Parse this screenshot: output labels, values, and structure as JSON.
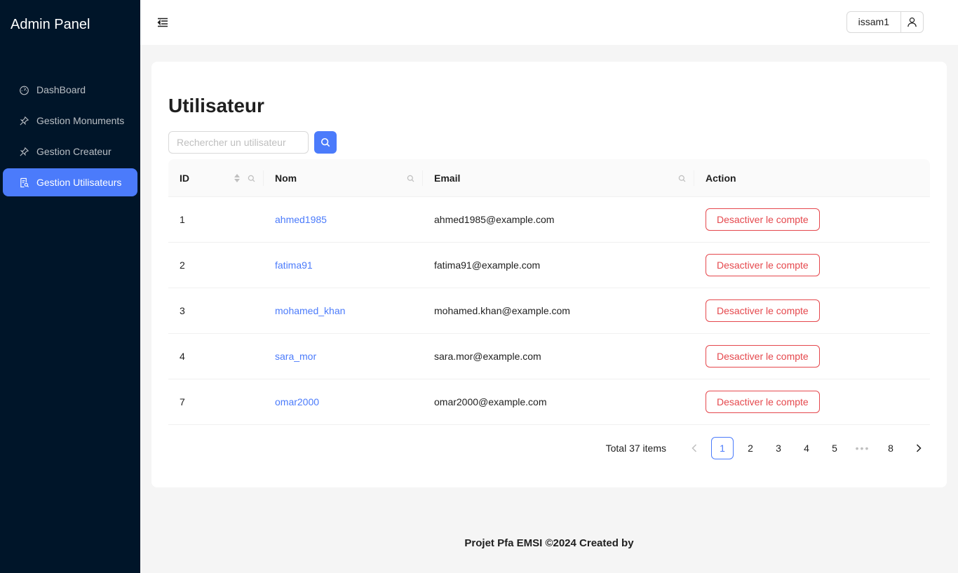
{
  "sidebar": {
    "brand": "Admin Panel",
    "items": [
      {
        "label": "DashBoard",
        "icon": "dashboard-icon",
        "active": false
      },
      {
        "label": "Gestion Monuments",
        "icon": "pushpin-icon",
        "active": false
      },
      {
        "label": "Gestion Createur",
        "icon": "pushpin-icon",
        "active": false
      },
      {
        "label": "Gestion Utilisateurs",
        "icon": "file-search-icon",
        "active": true
      }
    ]
  },
  "header": {
    "menu_icon": "menu-fold-icon",
    "username": "issam1",
    "user_icon": "user-icon"
  },
  "main": {
    "title": "Utilisateur",
    "search": {
      "placeholder": "Rechercher un utilisateur",
      "value": "",
      "button_icon": "search-icon"
    },
    "table": {
      "columns": [
        "ID",
        "Nom",
        "Email",
        "Action"
      ],
      "rows": [
        {
          "id": "1",
          "nom": "ahmed1985",
          "email": "ahmed1985@example.com",
          "action": "Desactiver le compte"
        },
        {
          "id": "2",
          "nom": "fatima91",
          "email": "fatima91@example.com",
          "action": "Desactiver le compte"
        },
        {
          "id": "3",
          "nom": "mohamed_khan",
          "email": "mohamed.khan@example.com",
          "action": "Desactiver le compte"
        },
        {
          "id": "4",
          "nom": "sara_mor",
          "email": "sara.mor@example.com",
          "action": "Desactiver le compte"
        },
        {
          "id": "7",
          "nom": "omar2000",
          "email": "omar2000@example.com",
          "action": "Desactiver le compte"
        }
      ]
    },
    "pagination": {
      "total_label": "Total 37 items",
      "pages": [
        "1",
        "2",
        "3",
        "4",
        "5"
      ],
      "ellipsis": "•••",
      "last_page": "8",
      "current": "1"
    }
  },
  "footer": {
    "text": "Projet Pfa EMSI ©2024 Created by"
  },
  "colors": {
    "sidebar_bg": "#001529",
    "accent": "#4b7bfb",
    "danger": "#e5484d",
    "content_bg": "#f5f5f5"
  }
}
